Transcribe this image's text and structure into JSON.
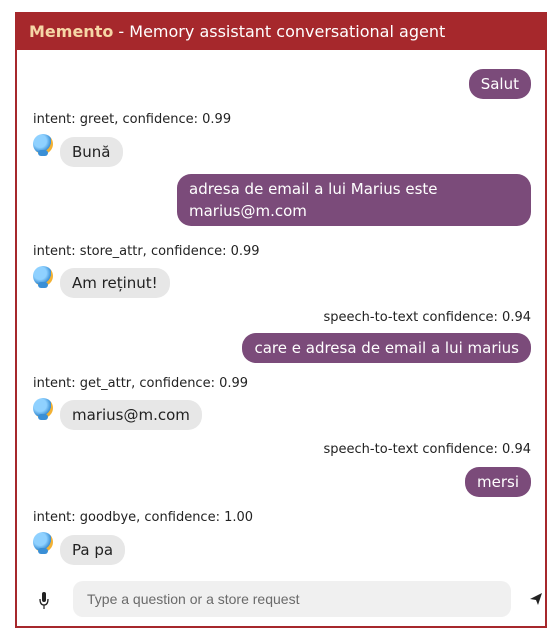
{
  "header": {
    "brand": "Memento",
    "separator": " - ",
    "subtitle": "Memory assistant conversational agent"
  },
  "messages": [
    {
      "from": "user",
      "text": "Salut"
    },
    {
      "from": "bot",
      "meta": "intent: greet, confidence: 0.99",
      "text": "Bună"
    },
    {
      "from": "user",
      "text_line1": "adresa de email a lui Marius este",
      "text_line2": "marius@m.com"
    },
    {
      "from": "bot",
      "meta": "intent: store_attr, confidence: 0.99",
      "text": "Am reținut!"
    },
    {
      "from": "user",
      "meta": "speech-to-text confidence: 0.94",
      "text": "care e adresa de email a lui marius"
    },
    {
      "from": "bot",
      "meta": "intent: get_attr, confidence: 0.99",
      "text": "marius@m.com"
    },
    {
      "from": "user",
      "meta": "speech-to-text confidence: 0.94",
      "text": "mersi"
    },
    {
      "from": "bot",
      "meta": "intent: goodbye, confidence: 1.00",
      "text": "Pa pa"
    }
  ],
  "composer": {
    "placeholder": "Type a question or a store request",
    "mic_icon": "microphone-icon",
    "send_icon": "send-icon"
  },
  "colors": {
    "header": "#a6282c",
    "brand": "#f6d6a6",
    "user_bubble": "#7b4b7a",
    "bot_bubble": "#e7e7e7"
  }
}
